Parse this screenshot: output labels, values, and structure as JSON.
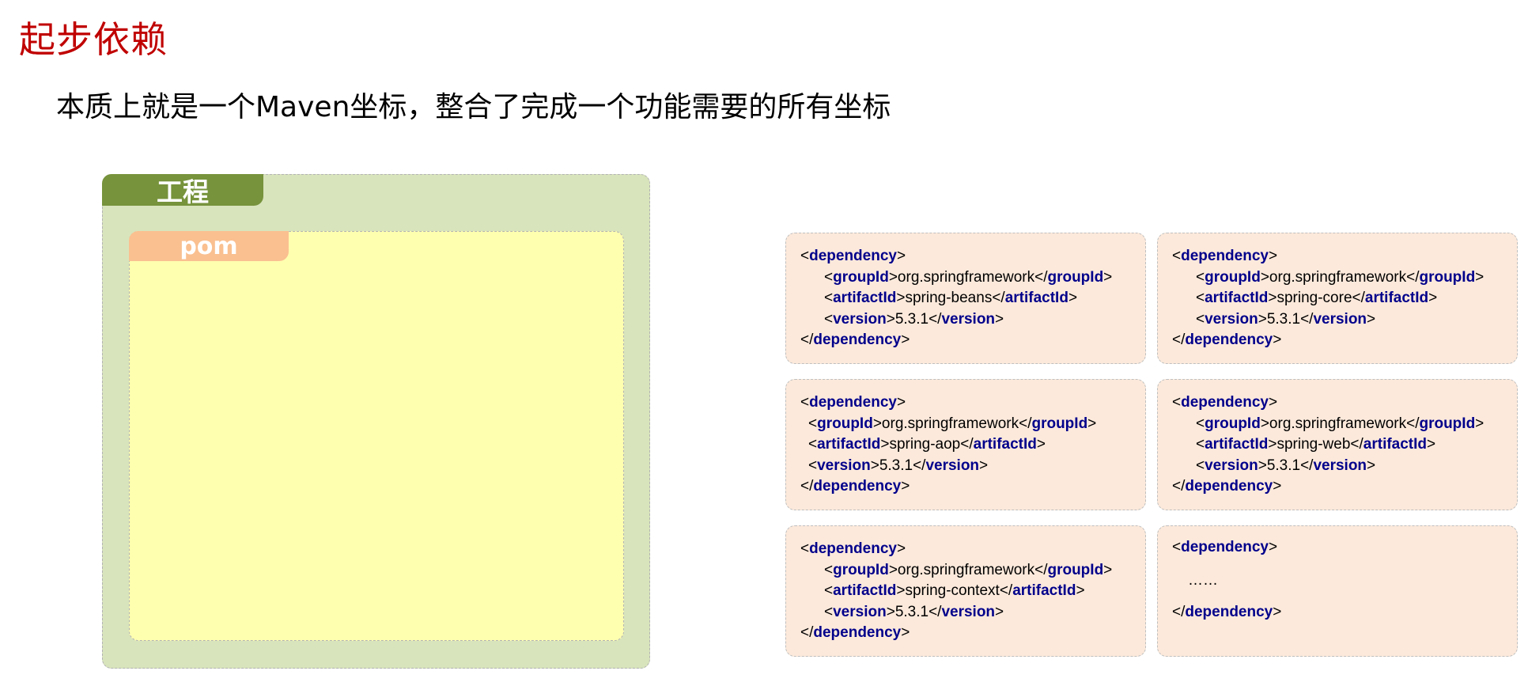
{
  "title": "起步依赖",
  "subtitle": "本质上就是一个Maven坐标，整合了完成一个功能需要的所有坐标",
  "project_label": "工程",
  "pom_label": "pom",
  "tags": {
    "dependency": "dependency",
    "groupId": "groupId",
    "artifactId": "artifactId",
    "version": "version"
  },
  "dependencies": [
    {
      "groupId": "org.springframework",
      "artifactId": "spring-beans",
      "version": "5.3.1"
    },
    {
      "groupId": "org.springframework",
      "artifactId": "spring-core",
      "version": "5.3.1"
    },
    {
      "groupId": "org.springframework",
      "artifactId": "spring-aop",
      "version": "5.3.1"
    },
    {
      "groupId": "org.springframework",
      "artifactId": "spring-web",
      "version": "5.3.1"
    },
    {
      "groupId": "org.springframework",
      "artifactId": "spring-context",
      "version": "5.3.1"
    }
  ],
  "ellipsis": "……",
  "colors": {
    "title": "#c00000",
    "project_bg": "#d8e4bc",
    "project_tab": "#77933c",
    "pom_bg": "#ffffb0",
    "pom_tab": "#fac090",
    "dependency_bg": "#fce9db",
    "tag": "#00008b"
  }
}
